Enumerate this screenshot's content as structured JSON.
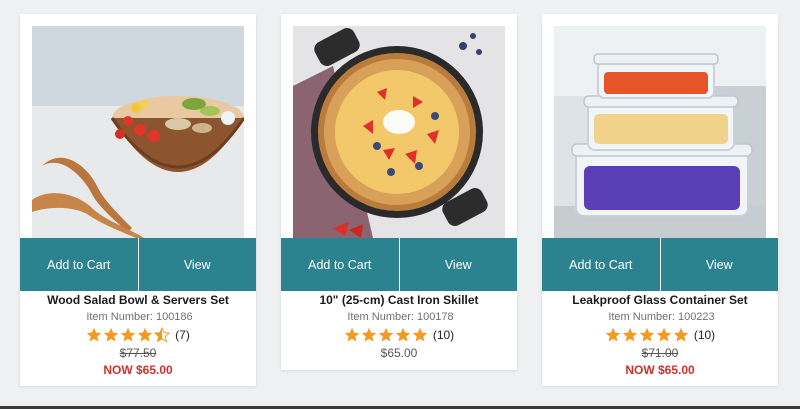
{
  "colors": {
    "button": "#2b8390",
    "star": "#f39a21",
    "sale": "#d0302a"
  },
  "products": [
    {
      "title": "Wood Salad Bowl & Servers Set",
      "item_label": "Item Number:",
      "item_number": "100186",
      "rating": 4.5,
      "review_count": "(7)",
      "original_price": "$77.50",
      "sale_price": "NOW $65.00",
      "add_to_cart": "Add to Cart",
      "view": "View"
    },
    {
      "title": "10\" (25-cm) Cast Iron Skillet",
      "item_label": "Item Number:",
      "item_number": "100178",
      "rating": 5,
      "review_count": "(10)",
      "price": "$65.00",
      "add_to_cart": "Add to Cart",
      "view": "View"
    },
    {
      "title": "Leakproof Glass Container Set",
      "item_label": "Item Number:",
      "item_number": "100223",
      "rating": 5,
      "review_count": "(10)",
      "original_price": "$71.00",
      "sale_price": "NOW $65.00",
      "add_to_cart": "Add to Cart",
      "view": "View"
    }
  ]
}
